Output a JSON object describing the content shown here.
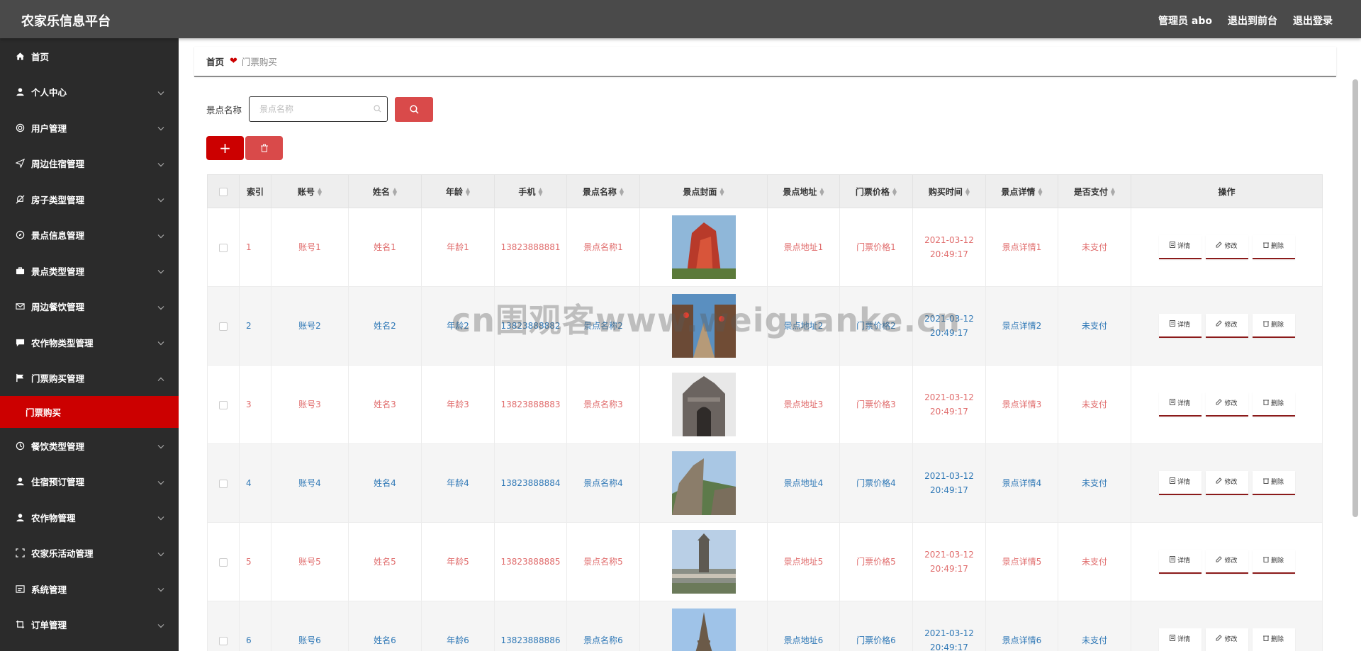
{
  "header": {
    "title": "农家乐信息平台",
    "admin": "管理员 abo",
    "front_link": "退出到前台",
    "logout": "退出登录"
  },
  "sidebar": {
    "items": [
      {
        "label": "首页",
        "icon": "home-icon",
        "has_children": false
      },
      {
        "label": "个人中心",
        "icon": "user-icon",
        "has_children": true
      },
      {
        "label": "用户管理",
        "icon": "circle-icon",
        "has_children": true
      },
      {
        "label": "周边住宿管理",
        "icon": "send-icon",
        "has_children": true
      },
      {
        "label": "房子类型管理",
        "icon": "bell-off-icon",
        "has_children": true
      },
      {
        "label": "景点信息管理",
        "icon": "compass-icon",
        "has_children": true
      },
      {
        "label": "景点类型管理",
        "icon": "briefcase-icon",
        "has_children": true
      },
      {
        "label": "周边餐饮管理",
        "icon": "mail-icon",
        "has_children": true
      },
      {
        "label": "农作物类型管理",
        "icon": "chat-icon",
        "has_children": true
      },
      {
        "label": "门票购买管理",
        "icon": "flag-icon",
        "has_children": true,
        "expanded": true
      }
    ],
    "active_sub": "门票购买",
    "items_after": [
      {
        "label": "餐饮类型管理",
        "icon": "clock-icon",
        "has_children": true
      },
      {
        "label": "住宿预订管理",
        "icon": "person-icon",
        "has_children": true
      },
      {
        "label": "农作物管理",
        "icon": "user-icon",
        "has_children": true
      },
      {
        "label": "农家乐活动管理",
        "icon": "fullscreen-icon",
        "has_children": true
      },
      {
        "label": "系统管理",
        "icon": "window-icon",
        "has_children": true
      },
      {
        "label": "订单管理",
        "icon": "crop-icon",
        "has_children": true
      }
    ]
  },
  "breadcrumb": {
    "home": "首页",
    "current": "门票购买"
  },
  "search": {
    "label": "景点名称",
    "placeholder": "景点名称"
  },
  "table": {
    "headers": [
      "",
      "索引",
      "账号",
      "姓名",
      "年龄",
      "手机",
      "景点名称",
      "景点封面",
      "景点地址",
      "门票价格",
      "购买时间",
      "景点详情",
      "是否支付",
      "操作"
    ],
    "sortable": [
      false,
      false,
      true,
      true,
      true,
      true,
      true,
      true,
      true,
      true,
      true,
      true,
      true,
      false
    ],
    "rows": [
      {
        "index": "1",
        "account": "账号1",
        "name": "姓名1",
        "age": "年龄1",
        "phone": "13823888881",
        "spot": "景点名称1",
        "cover": "red-rock-photo",
        "address": "景点地址1",
        "price": "门票价格1",
        "time": "2021-03-12 20:49:17",
        "detail": "景点详情1",
        "paid": "未支付"
      },
      {
        "index": "2",
        "account": "账号2",
        "name": "姓名2",
        "age": "年龄2",
        "phone": "13823888882",
        "spot": "景点名称2",
        "cover": "old-street-photo",
        "address": "景点地址2",
        "price": "门票价格2",
        "time": "2021-03-12 20:49:17",
        "detail": "景点详情2",
        "paid": "未支付"
      },
      {
        "index": "3",
        "account": "账号3",
        "name": "姓名3",
        "age": "年龄3",
        "phone": "13823888883",
        "spot": "景点名称3",
        "cover": "stone-gate-photo",
        "address": "景点地址3",
        "price": "门票价格3",
        "time": "2021-03-12 20:49:17",
        "detail": "景点详情3",
        "paid": "未支付"
      },
      {
        "index": "4",
        "account": "账号4",
        "name": "姓名4",
        "age": "年龄4",
        "phone": "13823888884",
        "spot": "景点名称4",
        "cover": "great-wall-photo",
        "address": "景点地址4",
        "price": "门票价格4",
        "time": "2021-03-12 20:49:17",
        "detail": "景点详情4",
        "paid": "未支付"
      },
      {
        "index": "5",
        "account": "账号5",
        "name": "姓名5",
        "age": "年龄5",
        "phone": "13823888885",
        "spot": "景点名称5",
        "cover": "monument-hill-photo",
        "address": "景点地址5",
        "price": "门票价格5",
        "time": "2021-03-12 20:49:17",
        "detail": "景点详情5",
        "paid": "未支付"
      },
      {
        "index": "6",
        "account": "账号6",
        "name": "姓名6",
        "age": "年龄6",
        "phone": "13823888886",
        "spot": "景点名称6",
        "cover": "eiffel-tower-photo",
        "address": "景点地址6",
        "price": "门票价格6",
        "time": "2021-03-12 20:49:17",
        "detail": "景点详情6",
        "paid": "未支付"
      }
    ],
    "actions": {
      "detail": "详情",
      "edit": "修改",
      "delete": "删除"
    }
  },
  "watermark": "cn围观客www.weiguanke.cn",
  "colors": {
    "header_bg": "#4a4a4a",
    "sidebar_bg": "#2b2b2b",
    "accent": "#cc0000",
    "odd_text": "#e06c6c",
    "even_text": "#2f78b6"
  }
}
